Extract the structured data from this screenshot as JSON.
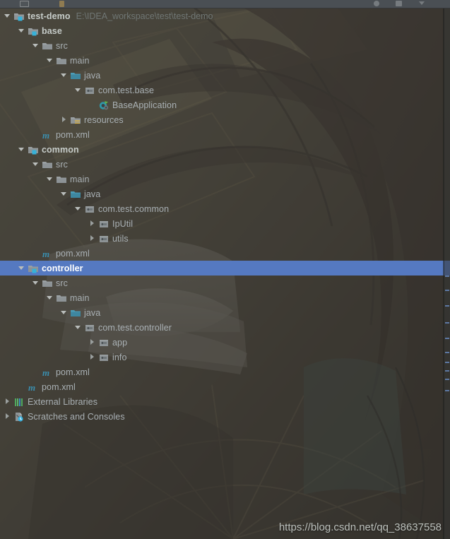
{
  "window": {
    "toolbar_icons": [
      "window-icon",
      "pin-icon",
      "settings-gear-icon",
      "minimize-icon",
      "collapse-icon"
    ]
  },
  "tree": {
    "rows": [
      {
        "id": "test-demo",
        "label": "test-demo",
        "path_hint": "E:\\IDEA_workspace\\test\\test-demo",
        "depth": 0,
        "arrow": "expanded",
        "icon": "module-folder-icon",
        "bold": true,
        "selected": false
      },
      {
        "id": "base",
        "label": "base",
        "path_hint": "",
        "depth": 1,
        "arrow": "expanded",
        "icon": "module-folder-icon",
        "bold": true,
        "selected": false
      },
      {
        "id": "base-src",
        "label": "src",
        "path_hint": "",
        "depth": 2,
        "arrow": "expanded",
        "icon": "folder-icon",
        "bold": false,
        "selected": false
      },
      {
        "id": "base-main",
        "label": "main",
        "path_hint": "",
        "depth": 3,
        "arrow": "expanded",
        "icon": "folder-icon",
        "bold": false,
        "selected": false
      },
      {
        "id": "base-java",
        "label": "java",
        "path_hint": "",
        "depth": 4,
        "arrow": "expanded",
        "icon": "source-root-icon",
        "bold": false,
        "selected": false
      },
      {
        "id": "com-test-base",
        "label": "com.test.base",
        "path_hint": "",
        "depth": 5,
        "arrow": "expanded",
        "icon": "package-icon",
        "bold": false,
        "selected": false
      },
      {
        "id": "BaseApplication",
        "label": "BaseApplication",
        "path_hint": "",
        "depth": 6,
        "arrow": "none",
        "icon": "spring-class-icon",
        "bold": false,
        "selected": false
      },
      {
        "id": "base-resources",
        "label": "resources",
        "path_hint": "",
        "depth": 4,
        "arrow": "collapsed",
        "icon": "resource-folder-icon",
        "bold": false,
        "selected": false
      },
      {
        "id": "base-pom",
        "label": "pom.xml",
        "path_hint": "",
        "depth": 2,
        "arrow": "none",
        "icon": "maven-icon",
        "bold": false,
        "selected": false
      },
      {
        "id": "common",
        "label": "common",
        "path_hint": "",
        "depth": 1,
        "arrow": "expanded",
        "icon": "module-folder-icon",
        "bold": true,
        "selected": false
      },
      {
        "id": "common-src",
        "label": "src",
        "path_hint": "",
        "depth": 2,
        "arrow": "expanded",
        "icon": "folder-icon",
        "bold": false,
        "selected": false
      },
      {
        "id": "common-main",
        "label": "main",
        "path_hint": "",
        "depth": 3,
        "arrow": "expanded",
        "icon": "folder-icon",
        "bold": false,
        "selected": false
      },
      {
        "id": "common-java",
        "label": "java",
        "path_hint": "",
        "depth": 4,
        "arrow": "expanded",
        "icon": "source-root-icon",
        "bold": false,
        "selected": false
      },
      {
        "id": "com-test-common",
        "label": "com.test.common",
        "path_hint": "",
        "depth": 5,
        "arrow": "expanded",
        "icon": "package-icon",
        "bold": false,
        "selected": false
      },
      {
        "id": "IpUtil",
        "label": "IpUtil",
        "path_hint": "",
        "depth": 6,
        "arrow": "collapsed",
        "icon": "package-icon",
        "bold": false,
        "selected": false
      },
      {
        "id": "utils",
        "label": "utils",
        "path_hint": "",
        "depth": 6,
        "arrow": "collapsed",
        "icon": "package-icon",
        "bold": false,
        "selected": false
      },
      {
        "id": "common-pom",
        "label": "pom.xml",
        "path_hint": "",
        "depth": 2,
        "arrow": "none",
        "icon": "maven-icon",
        "bold": false,
        "selected": false
      },
      {
        "id": "controller",
        "label": "controller",
        "path_hint": "",
        "depth": 1,
        "arrow": "expanded",
        "icon": "module-folder-icon",
        "bold": true,
        "selected": true
      },
      {
        "id": "controller-src",
        "label": "src",
        "path_hint": "",
        "depth": 2,
        "arrow": "expanded",
        "icon": "folder-icon",
        "bold": false,
        "selected": false
      },
      {
        "id": "controller-main",
        "label": "main",
        "path_hint": "",
        "depth": 3,
        "arrow": "expanded",
        "icon": "folder-icon",
        "bold": false,
        "selected": false
      },
      {
        "id": "controller-java",
        "label": "java",
        "path_hint": "",
        "depth": 4,
        "arrow": "expanded",
        "icon": "source-root-icon",
        "bold": false,
        "selected": false
      },
      {
        "id": "com-test-controller",
        "label": "com.test.controller",
        "path_hint": "",
        "depth": 5,
        "arrow": "expanded",
        "icon": "package-icon",
        "bold": false,
        "selected": false
      },
      {
        "id": "app",
        "label": "app",
        "path_hint": "",
        "depth": 6,
        "arrow": "collapsed",
        "icon": "package-icon",
        "bold": false,
        "selected": false
      },
      {
        "id": "info",
        "label": "info",
        "path_hint": "",
        "depth": 6,
        "arrow": "collapsed",
        "icon": "package-icon",
        "bold": false,
        "selected": false
      },
      {
        "id": "controller-pom",
        "label": "pom.xml",
        "path_hint": "",
        "depth": 2,
        "arrow": "none",
        "icon": "maven-icon",
        "bold": false,
        "selected": false
      },
      {
        "id": "root-pom",
        "label": "pom.xml",
        "path_hint": "",
        "depth": 1,
        "arrow": "none",
        "icon": "maven-icon",
        "bold": false,
        "selected": false
      },
      {
        "id": "external-libraries",
        "label": "External Libraries",
        "path_hint": "",
        "depth": 0,
        "arrow": "collapsed",
        "icon": "external-libraries-icon",
        "bold": false,
        "selected": false
      },
      {
        "id": "scratches",
        "label": "Scratches and Consoles",
        "path_hint": "",
        "depth": 0,
        "arrow": "collapsed",
        "icon": "scratches-icon",
        "bold": false,
        "selected": false
      }
    ]
  },
  "watermark": {
    "text": "https://blog.csdn.net/qq_38637558"
  },
  "colors": {
    "selection": "#5579c1",
    "text": "#a9b0b4",
    "text_bold": "#c6ccc9",
    "path_hint": "#6f7674",
    "source_root": "#3e87a0",
    "module_badge": "#36b2d9",
    "maven": "#3a8fb0"
  }
}
